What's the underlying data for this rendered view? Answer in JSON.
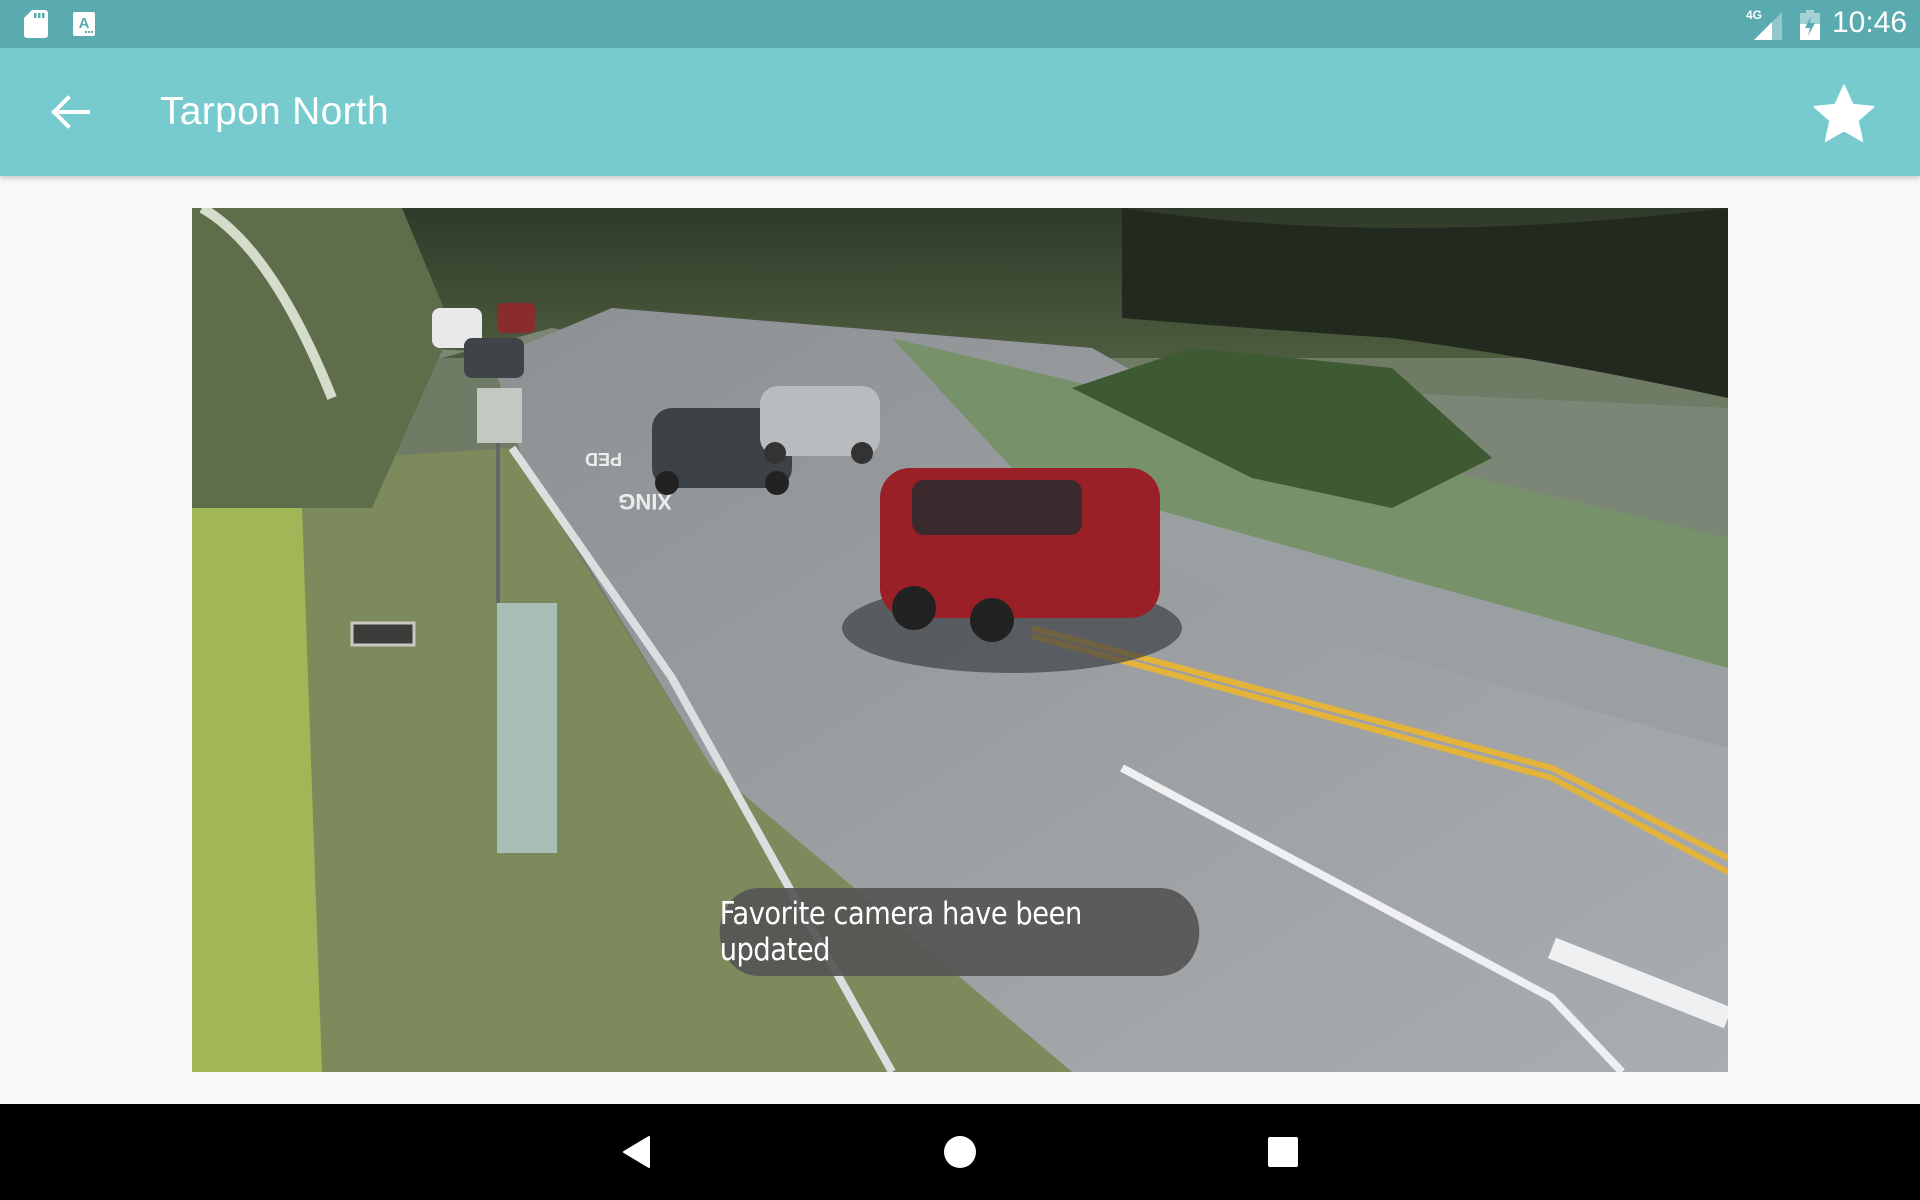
{
  "status_bar": {
    "left_icons": [
      "sd-card-icon",
      "keyboard-a-icon"
    ],
    "network_label": "4G",
    "right_icons": [
      "signal-4g-icon",
      "battery-charging-icon"
    ],
    "time": "10:46"
  },
  "app_bar": {
    "back_icon": "arrow-left-icon",
    "title": "Tarpon North",
    "favorite_icon": "star-icon",
    "favorite_active": true
  },
  "camera": {
    "name": "Tarpon North",
    "road_markings": [
      "PED",
      "XING"
    ]
  },
  "toast": {
    "message": "Favorite camera have been updated"
  },
  "nav_bar": {
    "buttons": [
      {
        "name": "back",
        "icon": "triangle-back-icon"
      },
      {
        "name": "home",
        "icon": "circle-home-icon"
      },
      {
        "name": "recents",
        "icon": "square-recents-icon"
      }
    ]
  },
  "colors": {
    "status_bar": "#5aabaf",
    "app_bar": "#77cacd",
    "background": "#fafafa",
    "toast": "#555555",
    "nav_bar": "#000000"
  }
}
